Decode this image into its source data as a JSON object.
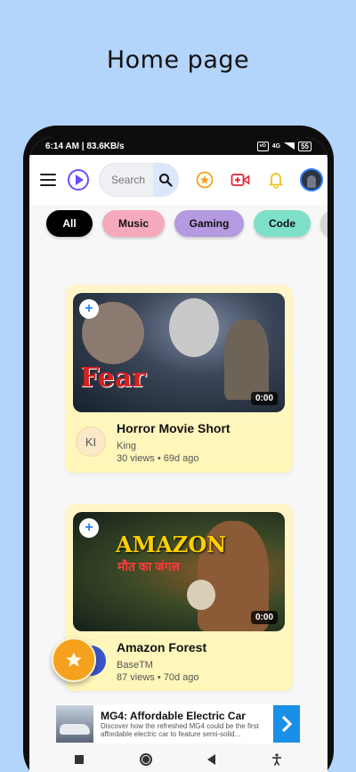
{
  "heading": "Home page",
  "status": {
    "time": "6:14 AM | 83.6KB/s",
    "sim": "ᵛᴼ",
    "network": "4G",
    "battery": "55"
  },
  "search": {
    "placeholder": "Search"
  },
  "chips": [
    "All",
    "Music",
    "Gaming",
    "Code"
  ],
  "videos": [
    {
      "thumb_title": "Fear",
      "duration": "0:00",
      "title": "Horror Movie Short",
      "channel_initials": "KI",
      "channel": "King",
      "stats": "30 views • 69d ago"
    },
    {
      "thumb_title": "AMAZON",
      "thumb_subtitle": "मौत का जंगल",
      "duration": "0:00",
      "title": "Amazon Forest",
      "channel": "BaseTM",
      "stats": "87 views • 70d ago"
    }
  ],
  "ad": {
    "title": "MG4: Affordable Electric Car",
    "description": "Discover how the refreshed MG4 could be the first affordable electric car to feature semi-solid..."
  },
  "colors": {
    "accent": "#6c4cff",
    "star": "#f5a11e",
    "video_upload": "#e8263a",
    "bell": "#f3c21a",
    "page_bg": "#b3d4fb"
  },
  "icons": {
    "menu": "menu-icon",
    "logo": "play-logo-icon",
    "search": "search-icon",
    "favorites": "star-icon",
    "upload": "video-plus-icon",
    "notifications": "bell-icon",
    "fab": "star-icon",
    "ad_arrow": "chevron-right-icon"
  }
}
